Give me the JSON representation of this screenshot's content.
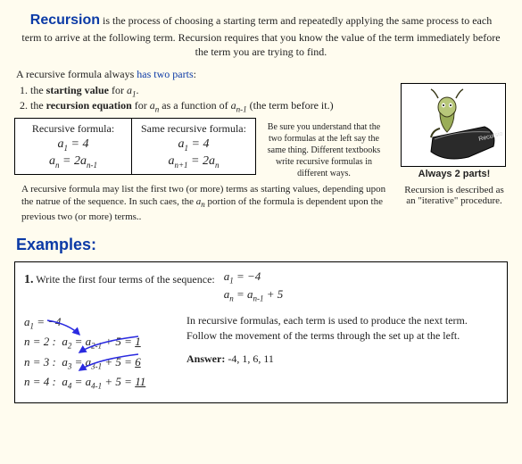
{
  "title_word": "Recursion",
  "intro_rest": " is the process of choosing a starting term and repeatedly applying the same process to each term to arrive at the following term.  Recursion requires that you know the value of the term immediately before the term you are trying to find.",
  "parts_lead": "A recursive formula always ",
  "parts_link": "has two parts",
  "item1_a": "the ",
  "item1_b": "starting value",
  "item1_c": " for ",
  "item2_a": "the ",
  "item2_b": "recursion equation",
  "item2_c": " for ",
  "item2_d": " as a function of ",
  "item2_e": " (the term before it.)",
  "col1_head": "Recursive formula:",
  "col2_head": "Same recursive formula:",
  "tip": "Be sure you understand that the two formulas at the left say the same thing. Different textbooks write recursive formulas in different ways.",
  "caption": "Always 2 parts!",
  "iterative_a": "Recursion is described as",
  "iterative_b": "an \"iterative\" procedure.",
  "note_a": "A recursive formula may list the first two (or more) terms as starting values, depending upon the natrue of the sequence. In such caes, the ",
  "note_b": " portion of the formula is dependent upon the previous two (or more) terms..",
  "examples": "Examples:",
  "ex_num": "1.",
  "ex_prompt": "Write the first four terms of the sequence:",
  "explain_text": "In recursive formulas, each term is used to produce the next term.  Follow the movement of the terms through the set up at the left.",
  "answer_label": "Answer:",
  "answer_vals": "  -4, 1, 6, 11"
}
